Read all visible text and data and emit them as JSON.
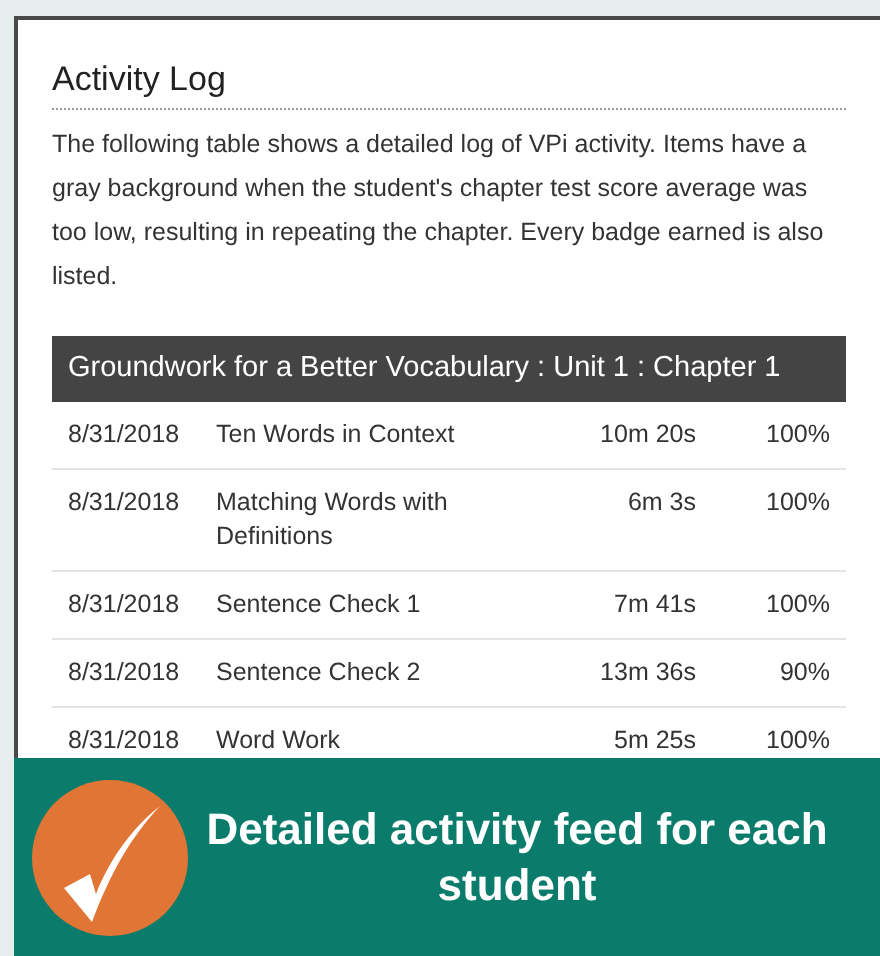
{
  "heading": "Activity Log",
  "description": "The following table shows a detailed log of VPi activity. Items have a gray background when the student's chapter test score average was too low, resulting in repeating the chapter. Every badge earned is also listed.",
  "table": {
    "title": "Groundwork for a Better Vocabulary : Unit 1 : Chapter 1",
    "rows": [
      {
        "date": "8/31/2018",
        "activity": "Ten Words in Context",
        "time": "10m 20s",
        "score": "100%"
      },
      {
        "date": "8/31/2018",
        "activity": "Matching Words with Definitions",
        "time": "6m 3s",
        "score": "100%"
      },
      {
        "date": "8/31/2018",
        "activity": "Sentence Check 1",
        "time": "7m 41s",
        "score": "100%"
      },
      {
        "date": "8/31/2018",
        "activity": "Sentence Check 2",
        "time": "13m 36s",
        "score": "90%"
      },
      {
        "date": "8/31/2018",
        "activity": "Word Work",
        "time": "5m 25s",
        "score": "100%"
      }
    ]
  },
  "banner": {
    "text": "Detailed activity feed for each student"
  }
}
